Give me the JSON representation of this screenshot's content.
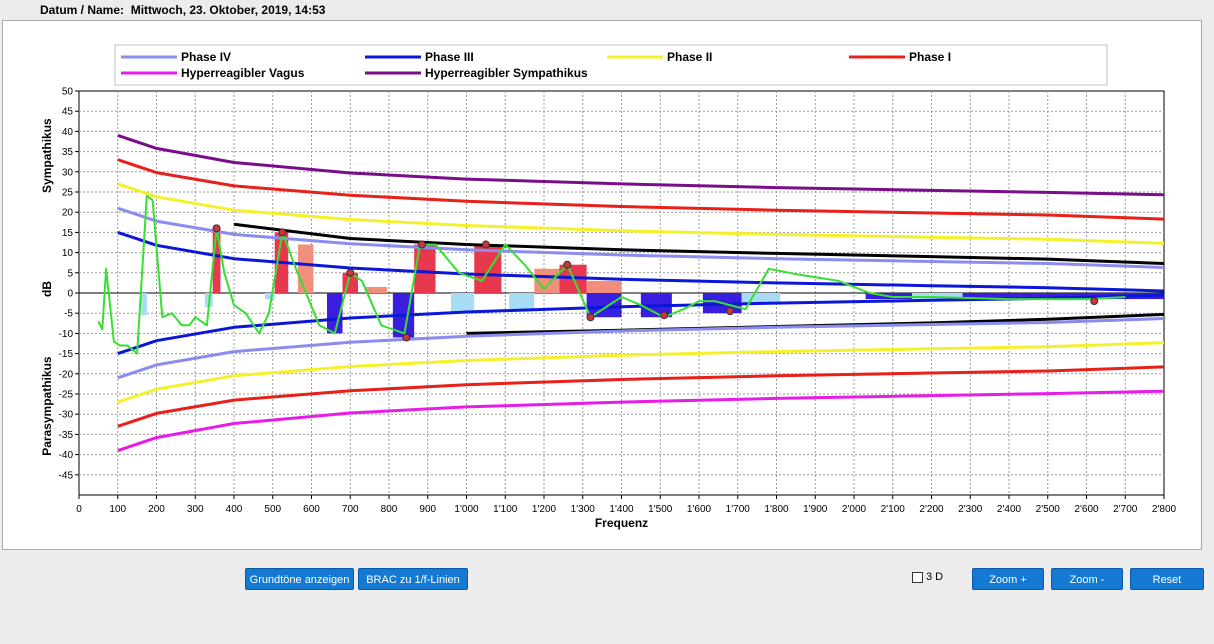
{
  "header": {
    "label": "Datum / Name:",
    "value": "Mittwoch, 23. Oktober, 2019, 14:53"
  },
  "buttons": {
    "grundtoene": "Grundtöne anzeigen",
    "brac": "BRAC zu 1/f-Linien",
    "zoom_in": "Zoom +",
    "zoom_out": "Zoom -",
    "reset": "Reset"
  },
  "checkbox_3d": {
    "label": "3 D",
    "checked": false
  },
  "colors": {
    "phase_iv": "#8a8cf0",
    "phase_iii": "#0a17d8",
    "phase_ii": "#f6f02a",
    "phase_i": "#e8201a",
    "vagus": "#e81ce8",
    "sympathikus": "#7a0e8a",
    "reference": "#000000",
    "measured": "#35e030",
    "bar_red": "#e8384e",
    "bar_salmon": "#f0907c",
    "bar_blue": "#3a1ee0",
    "bar_lightblue": "#a8dcf6"
  },
  "chart_data": {
    "type": "line",
    "title": "",
    "xlabel": "Frequenz",
    "ylabel": "dB",
    "ylabel_top": "Sympathikus",
    "ylabel_bottom": "Parasympathikus",
    "xlim": [
      0,
      2800
    ],
    "ylim": [
      -50,
      50
    ],
    "grid": true,
    "legend_position": "top",
    "x_ticks": [
      0,
      100,
      200,
      300,
      400,
      500,
      600,
      700,
      800,
      900,
      1000,
      1100,
      1200,
      1300,
      1400,
      1500,
      1600,
      1700,
      1800,
      1900,
      2000,
      2100,
      2200,
      2300,
      2400,
      2500,
      2600,
      2700,
      2800
    ],
    "x_tick_labels": [
      "0",
      "100",
      "200",
      "300",
      "400",
      "500",
      "600",
      "700",
      "800",
      "900",
      "1'000",
      "1'100",
      "1'200",
      "1'300",
      "1'400",
      "1'500",
      "1'600",
      "1'700",
      "1'800",
      "1'900",
      "2'000",
      "2'100",
      "2'200",
      "2'300",
      "2'400",
      "2'500",
      "2'600",
      "2'700",
      "2'800"
    ],
    "y_ticks": [
      50,
      45,
      40,
      35,
      30,
      25,
      20,
      15,
      10,
      5,
      0,
      -5,
      -10,
      -15,
      -20,
      -25,
      -30,
      -35,
      -40,
      -45
    ],
    "y_tick_labels": [
      "50",
      "45",
      "40",
      "35",
      "30",
      "25",
      "20",
      "15",
      "10",
      "5",
      "0",
      "-5",
      "-10",
      "-15",
      "-20",
      "-25",
      "-30",
      "-35",
      "-40",
      "-45"
    ],
    "legend": [
      {
        "name": "Phase IV",
        "color": "#8a8cf0"
      },
      {
        "name": "Phase III",
        "color": "#0a17d8"
      },
      {
        "name": "Phase II",
        "color": "#f6f02a"
      },
      {
        "name": "Phase I",
        "color": "#e8201a"
      },
      {
        "name": "Hyperreagibler Vagus",
        "color": "#e81ce8"
      },
      {
        "name": "Hyperreagibler Sympathikus",
        "color": "#7a0e8a"
      }
    ],
    "curves": {
      "x": [
        100,
        200,
        400,
        700,
        1000,
        1400,
        1800,
        2200,
        2500,
        2800
      ],
      "sympathikus_top": [
        39,
        35.8,
        32.3,
        29.7,
        28.2,
        27,
        26.1,
        25.4,
        24.9,
        24.3
      ],
      "phase_i_top": [
        33,
        29.8,
        26.5,
        24.2,
        22.7,
        21.4,
        20.5,
        19.8,
        19.3,
        18.3
      ],
      "phase_ii_top": [
        27,
        23.8,
        20.5,
        18.2,
        16.7,
        15.4,
        14.5,
        13.8,
        13.3,
        12.3
      ],
      "phase_iv_top": [
        21,
        17.8,
        14.5,
        12.2,
        10.7,
        9.4,
        8.5,
        7.8,
        7.3,
        6.3
      ],
      "reference_top": [
        null,
        null,
        17,
        13.5,
        12,
        10.7,
        9.8,
        9,
        8.4,
        7.3
      ],
      "phase_iii_top": [
        15,
        11.8,
        8.5,
        6.2,
        4.7,
        3.4,
        2.5,
        1.8,
        1.3,
        0.5
      ],
      "phase_iii_bottom": [
        -15,
        -11.8,
        -8.5,
        -6.2,
        -4.7,
        -3.4,
        -2.5,
        -1.8,
        -1.3,
        -0.5
      ],
      "reference_bottom": [
        null,
        null,
        null,
        null,
        -10,
        -9.2,
        -8.3,
        -7.4,
        -6.5,
        -5.3
      ],
      "phase_iv_bottom": [
        -21,
        -17.8,
        -14.5,
        -12.2,
        -10.7,
        -9.4,
        -8.5,
        -7.8,
        -7.3,
        -6.3
      ],
      "phase_ii_bottom": [
        -27,
        -23.8,
        -20.5,
        -18.2,
        -16.7,
        -15.4,
        -14.5,
        -13.8,
        -13.3,
        -12.3
      ],
      "phase_i_bottom": [
        -33,
        -29.8,
        -26.5,
        -24.2,
        -22.7,
        -21.4,
        -20.5,
        -19.8,
        -19.3,
        -18.3
      ],
      "vagus_bottom": [
        -39,
        -35.8,
        -32.3,
        -29.7,
        -28.2,
        -27,
        -26.1,
        -25.4,
        -24.9,
        -24.3
      ]
    },
    "bars": [
      {
        "x0": 160,
        "x1": 175,
        "value": -5.5,
        "color": "#a8dcf6"
      },
      {
        "x0": 325,
        "x1": 345,
        "value": -3.5,
        "color": "#a8dcf6"
      },
      {
        "x0": 345,
        "x1": 365,
        "value": 16,
        "color": "#e8384e"
      },
      {
        "x0": 480,
        "x1": 505,
        "value": -1.5,
        "color": "#a8dcf6"
      },
      {
        "x0": 505,
        "x1": 540,
        "value": 15,
        "color": "#e8384e"
      },
      {
        "x0": 565,
        "x1": 605,
        "value": 12,
        "color": "#f0907c"
      },
      {
        "x0": 640,
        "x1": 680,
        "value": -10,
        "color": "#3a1ee0"
      },
      {
        "x0": 680,
        "x1": 720,
        "value": 5,
        "color": "#e8384e"
      },
      {
        "x0": 740,
        "x1": 795,
        "value": 1.5,
        "color": "#f0907c"
      },
      {
        "x0": 810,
        "x1": 865,
        "value": -11,
        "color": "#3a1ee0"
      },
      {
        "x0": 865,
        "x1": 920,
        "value": 12,
        "color": "#e8384e"
      },
      {
        "x0": 960,
        "x1": 1020,
        "value": -5,
        "color": "#a8dcf6"
      },
      {
        "x0": 1020,
        "x1": 1090,
        "value": 12,
        "color": "#e8384e"
      },
      {
        "x0": 1110,
        "x1": 1175,
        "value": -4.5,
        "color": "#a8dcf6"
      },
      {
        "x0": 1175,
        "x1": 1240,
        "value": 6,
        "color": "#f0907c"
      },
      {
        "x0": 1240,
        "x1": 1310,
        "value": 7,
        "color": "#e8384e"
      },
      {
        "x0": 1310,
        "x1": 1400,
        "value": 3,
        "color": "#f0907c"
      },
      {
        "x0": 1310,
        "x1": 1400,
        "value": -6,
        "color": "#3a1ee0"
      },
      {
        "x0": 1450,
        "x1": 1530,
        "value": -6,
        "color": "#3a1ee0"
      },
      {
        "x0": 1610,
        "x1": 1710,
        "value": -5,
        "color": "#3a1ee0"
      },
      {
        "x0": 1710,
        "x1": 1810,
        "value": -2.5,
        "color": "#a8dcf6"
      },
      {
        "x0": 2030,
        "x1": 2150,
        "value": -1.5,
        "color": "#3a1ee0"
      },
      {
        "x0": 2150,
        "x1": 2280,
        "value": -1.5,
        "color": "#a8dcf6"
      },
      {
        "x0": 2280,
        "x1": 2430,
        "value": -1.5,
        "color": "#3a1ee0"
      },
      {
        "x0": 2430,
        "x1": 2560,
        "value": -1.5,
        "color": "#3a1ee0"
      },
      {
        "x0": 2560,
        "x1": 2800,
        "value": -1.5,
        "color": "#3a1ee0"
      }
    ],
    "measured_line": {
      "x": [
        50,
        60,
        70,
        90,
        105,
        125,
        150,
        175,
        190,
        215,
        240,
        265,
        285,
        300,
        330,
        355,
        375,
        400,
        430,
        465,
        490,
        525,
        560,
        620,
        660,
        700,
        730,
        780,
        840,
        880,
        920,
        980,
        1040,
        1100,
        1150,
        1200,
        1260,
        1320,
        1400,
        1450,
        1510,
        1560,
        1600,
        1640,
        1680,
        1720,
        1780,
        1860,
        1960,
        2040,
        2100,
        2200,
        2400,
        2600,
        2700
      ],
      "y": [
        -7,
        -9,
        6,
        -12,
        -13,
        -13,
        -15,
        24,
        23,
        -6,
        -5,
        -8,
        -8,
        -6,
        -8,
        16,
        5,
        -3,
        -5,
        -10,
        -5,
        15,
        6,
        -8,
        -10,
        5,
        3,
        -8,
        -10,
        12,
        12,
        5,
        3,
        12,
        7,
        1,
        7,
        -6,
        -1,
        -3,
        -6,
        -4,
        -2,
        -2,
        -3,
        -4,
        6,
        4.5,
        3,
        0,
        -1,
        -1,
        -1.5,
        -1.5,
        -1
      ]
    },
    "markers": {
      "x": [
        355,
        525,
        700,
        845,
        885,
        1050,
        1260,
        1320,
        1510,
        1680,
        2620
      ],
      "y": [
        16,
        15,
        5,
        -11,
        12,
        12,
        7,
        -6,
        -5.5,
        -4.5,
        -2
      ]
    }
  }
}
